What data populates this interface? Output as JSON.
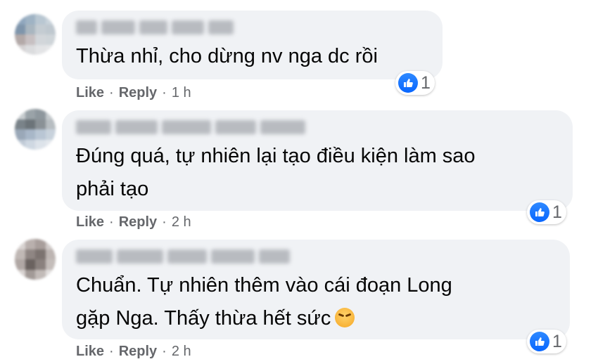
{
  "colors": {
    "bubble": "#f0f2f5",
    "like_blue": "#0866ff",
    "meta": "#65676b",
    "text": "#050505"
  },
  "icons": {
    "reaction": "like-thumb-icon"
  },
  "comments": [
    {
      "text_lines": [
        "Thừa nhỉ, cho dừng nv nga dc rồi"
      ],
      "reactions": "1",
      "like_label": "Like",
      "reply_label": "Reply",
      "separator": "·",
      "time": "1 h"
    },
    {
      "text_lines": [
        "Đúng quá, tự nhiên lại tạo điều kiện làm sao",
        "phải tạo"
      ],
      "reactions": "1",
      "like_label": "Like",
      "reply_label": "Reply",
      "separator": "·",
      "time": "2 h"
    },
    {
      "text_lines": [
        "Chuẩn. Tự nhiên thêm vào cái đoạn Long",
        "gặp Nga. Thấy thừa hết sức"
      ],
      "emoji": "persevering-face-icon",
      "reactions": "1",
      "like_label": "Like",
      "reply_label": "Reply",
      "separator": "·",
      "time": "2 h"
    }
  ]
}
